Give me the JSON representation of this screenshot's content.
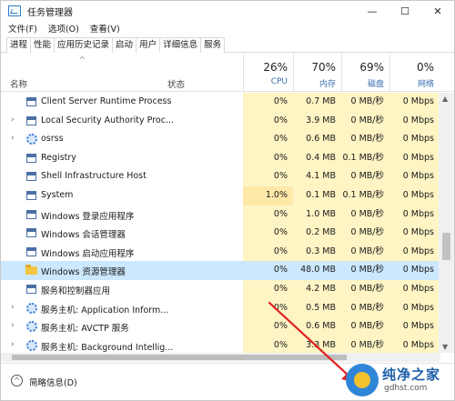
{
  "window": {
    "title": "任务管理器",
    "controls": [
      "—",
      "☐",
      "✕"
    ]
  },
  "menu": [
    "文件(F)",
    "选项(O)",
    "查看(V)"
  ],
  "tabs": [
    "进程",
    "性能",
    "应用历史记录",
    "启动",
    "用户",
    "详细信息",
    "服务"
  ],
  "active_tab": "进程",
  "columns": {
    "name": "名称",
    "status": "状态",
    "cpu": {
      "percent": "26%",
      "label": "CPU"
    },
    "memory": {
      "percent": "70%",
      "label": "内存"
    },
    "disk": {
      "percent": "69%",
      "label": "磁盘"
    },
    "network": {
      "percent": "0%",
      "label": "网络"
    }
  },
  "rows": [
    {
      "expand": "",
      "icon": "app-window-icon",
      "name": "Client Server Runtime Process",
      "cpu": "0%",
      "memory": "0.7 MB",
      "disk": "0 MB/秒",
      "network": "0 Mbps"
    },
    {
      "expand": "›",
      "icon": "app-window-icon",
      "name": "Local Security Authority Proc...",
      "cpu": "0%",
      "memory": "3.9 MB",
      "disk": "0 MB/秒",
      "network": "0 Mbps"
    },
    {
      "expand": "›",
      "icon": "gear-icon",
      "name": "osrss",
      "cpu": "0%",
      "memory": "0.6 MB",
      "disk": "0 MB/秒",
      "network": "0 Mbps"
    },
    {
      "expand": "",
      "icon": "app-window-icon",
      "name": "Registry",
      "cpu": "0%",
      "memory": "0.4 MB",
      "disk": "0.1 MB/秒",
      "network": "0 Mbps"
    },
    {
      "expand": "",
      "icon": "app-window-icon",
      "name": "Shell Infrastructure Host",
      "cpu": "0%",
      "memory": "4.1 MB",
      "disk": "0 MB/秒",
      "network": "0 Mbps"
    },
    {
      "expand": "",
      "icon": "app-window-icon",
      "name": "System",
      "cpu": "1.0%",
      "memory": "0.1 MB",
      "disk": "0.1 MB/秒",
      "network": "0 Mbps"
    },
    {
      "expand": "",
      "icon": "app-window-icon",
      "name": "Windows 登录应用程序",
      "cpu": "0%",
      "memory": "1.0 MB",
      "disk": "0 MB/秒",
      "network": "0 Mbps"
    },
    {
      "expand": "",
      "icon": "app-window-icon",
      "name": "Windows 会话管理器",
      "cpu": "0%",
      "memory": "0.2 MB",
      "disk": "0 MB/秒",
      "network": "0 Mbps"
    },
    {
      "expand": "",
      "icon": "app-window-icon",
      "name": "Windows 启动应用程序",
      "cpu": "0%",
      "memory": "0.3 MB",
      "disk": "0 MB/秒",
      "network": "0 Mbps"
    },
    {
      "expand": "",
      "icon": "folder-icon",
      "name": "Windows 资源管理器",
      "cpu": "0%",
      "memory": "48.0 MB",
      "disk": "0 MB/秒",
      "network": "0 Mbps",
      "selected": true
    },
    {
      "expand": "",
      "icon": "app-window-icon",
      "name": "服务和控制器应用",
      "cpu": "0%",
      "memory": "4.2 MB",
      "disk": "0 MB/秒",
      "network": "0 Mbps"
    },
    {
      "expand": "›",
      "icon": "gear-icon",
      "name": "服务主机: Application Inform...",
      "cpu": "0%",
      "memory": "0.5 MB",
      "disk": "0 MB/秒",
      "network": "0 Mbps"
    },
    {
      "expand": "›",
      "icon": "gear-icon",
      "name": "服务主机: AVCTP 服务",
      "cpu": "0%",
      "memory": "0.6 MB",
      "disk": "0 MB/秒",
      "network": "0 Mbps"
    },
    {
      "expand": "›",
      "icon": "gear-icon",
      "name": "服务主机: Background Intellig...",
      "cpu": "0%",
      "memory": "3.3 MB",
      "disk": "0 MB/秒",
      "network": "0 Mbps"
    }
  ],
  "footer": {
    "icon": "chevron-up-icon",
    "label": "简略信息(D)"
  },
  "watermark": {
    "title": "纯净之家",
    "site": "gdhst.com"
  },
  "colors": {
    "selected_row": "#cce8ff",
    "usage_cell": "#fff4c4",
    "annotation_arrow": "#e02020"
  }
}
